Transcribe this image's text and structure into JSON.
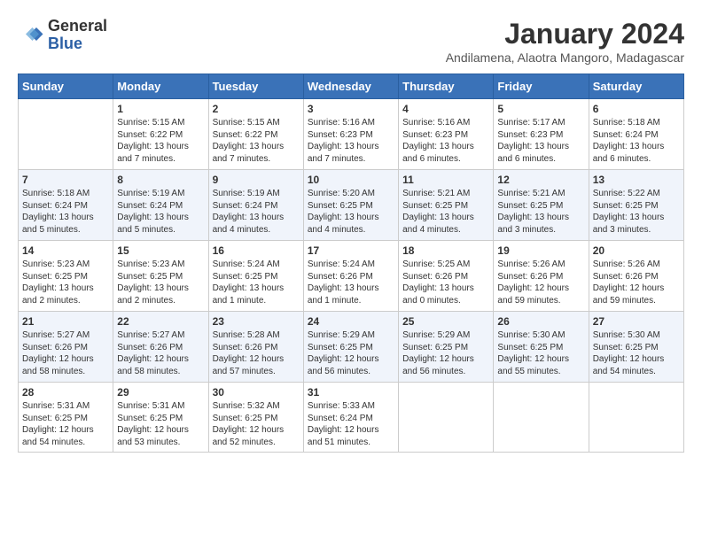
{
  "header": {
    "logo_line1": "General",
    "logo_line2": "Blue",
    "title": "January 2024",
    "subtitle": "Andilamena, Alaotra Mangoro, Madagascar"
  },
  "days_of_week": [
    "Sunday",
    "Monday",
    "Tuesday",
    "Wednesday",
    "Thursday",
    "Friday",
    "Saturday"
  ],
  "weeks": [
    [
      {
        "day": "",
        "content": ""
      },
      {
        "day": "1",
        "content": "Sunrise: 5:15 AM\nSunset: 6:22 PM\nDaylight: 13 hours\nand 7 minutes."
      },
      {
        "day": "2",
        "content": "Sunrise: 5:15 AM\nSunset: 6:22 PM\nDaylight: 13 hours\nand 7 minutes."
      },
      {
        "day": "3",
        "content": "Sunrise: 5:16 AM\nSunset: 6:23 PM\nDaylight: 13 hours\nand 7 minutes."
      },
      {
        "day": "4",
        "content": "Sunrise: 5:16 AM\nSunset: 6:23 PM\nDaylight: 13 hours\nand 6 minutes."
      },
      {
        "day": "5",
        "content": "Sunrise: 5:17 AM\nSunset: 6:23 PM\nDaylight: 13 hours\nand 6 minutes."
      },
      {
        "day": "6",
        "content": "Sunrise: 5:18 AM\nSunset: 6:24 PM\nDaylight: 13 hours\nand 6 minutes."
      }
    ],
    [
      {
        "day": "7",
        "content": "Sunrise: 5:18 AM\nSunset: 6:24 PM\nDaylight: 13 hours\nand 5 minutes."
      },
      {
        "day": "8",
        "content": "Sunrise: 5:19 AM\nSunset: 6:24 PM\nDaylight: 13 hours\nand 5 minutes."
      },
      {
        "day": "9",
        "content": "Sunrise: 5:19 AM\nSunset: 6:24 PM\nDaylight: 13 hours\nand 4 minutes."
      },
      {
        "day": "10",
        "content": "Sunrise: 5:20 AM\nSunset: 6:25 PM\nDaylight: 13 hours\nand 4 minutes."
      },
      {
        "day": "11",
        "content": "Sunrise: 5:21 AM\nSunset: 6:25 PM\nDaylight: 13 hours\nand 4 minutes."
      },
      {
        "day": "12",
        "content": "Sunrise: 5:21 AM\nSunset: 6:25 PM\nDaylight: 13 hours\nand 3 minutes."
      },
      {
        "day": "13",
        "content": "Sunrise: 5:22 AM\nSunset: 6:25 PM\nDaylight: 13 hours\nand 3 minutes."
      }
    ],
    [
      {
        "day": "14",
        "content": "Sunrise: 5:23 AM\nSunset: 6:25 PM\nDaylight: 13 hours\nand 2 minutes."
      },
      {
        "day": "15",
        "content": "Sunrise: 5:23 AM\nSunset: 6:25 PM\nDaylight: 13 hours\nand 2 minutes."
      },
      {
        "day": "16",
        "content": "Sunrise: 5:24 AM\nSunset: 6:25 PM\nDaylight: 13 hours\nand 1 minute."
      },
      {
        "day": "17",
        "content": "Sunrise: 5:24 AM\nSunset: 6:26 PM\nDaylight: 13 hours\nand 1 minute."
      },
      {
        "day": "18",
        "content": "Sunrise: 5:25 AM\nSunset: 6:26 PM\nDaylight: 13 hours\nand 0 minutes."
      },
      {
        "day": "19",
        "content": "Sunrise: 5:26 AM\nSunset: 6:26 PM\nDaylight: 12 hours\nand 59 minutes."
      },
      {
        "day": "20",
        "content": "Sunrise: 5:26 AM\nSunset: 6:26 PM\nDaylight: 12 hours\nand 59 minutes."
      }
    ],
    [
      {
        "day": "21",
        "content": "Sunrise: 5:27 AM\nSunset: 6:26 PM\nDaylight: 12 hours\nand 58 minutes."
      },
      {
        "day": "22",
        "content": "Sunrise: 5:27 AM\nSunset: 6:26 PM\nDaylight: 12 hours\nand 58 minutes."
      },
      {
        "day": "23",
        "content": "Sunrise: 5:28 AM\nSunset: 6:26 PM\nDaylight: 12 hours\nand 57 minutes."
      },
      {
        "day": "24",
        "content": "Sunrise: 5:29 AM\nSunset: 6:25 PM\nDaylight: 12 hours\nand 56 minutes."
      },
      {
        "day": "25",
        "content": "Sunrise: 5:29 AM\nSunset: 6:25 PM\nDaylight: 12 hours\nand 56 minutes."
      },
      {
        "day": "26",
        "content": "Sunrise: 5:30 AM\nSunset: 6:25 PM\nDaylight: 12 hours\nand 55 minutes."
      },
      {
        "day": "27",
        "content": "Sunrise: 5:30 AM\nSunset: 6:25 PM\nDaylight: 12 hours\nand 54 minutes."
      }
    ],
    [
      {
        "day": "28",
        "content": "Sunrise: 5:31 AM\nSunset: 6:25 PM\nDaylight: 12 hours\nand 54 minutes."
      },
      {
        "day": "29",
        "content": "Sunrise: 5:31 AM\nSunset: 6:25 PM\nDaylight: 12 hours\nand 53 minutes."
      },
      {
        "day": "30",
        "content": "Sunrise: 5:32 AM\nSunset: 6:25 PM\nDaylight: 12 hours\nand 52 minutes."
      },
      {
        "day": "31",
        "content": "Sunrise: 5:33 AM\nSunset: 6:24 PM\nDaylight: 12 hours\nand 51 minutes."
      },
      {
        "day": "",
        "content": ""
      },
      {
        "day": "",
        "content": ""
      },
      {
        "day": "",
        "content": ""
      }
    ]
  ]
}
